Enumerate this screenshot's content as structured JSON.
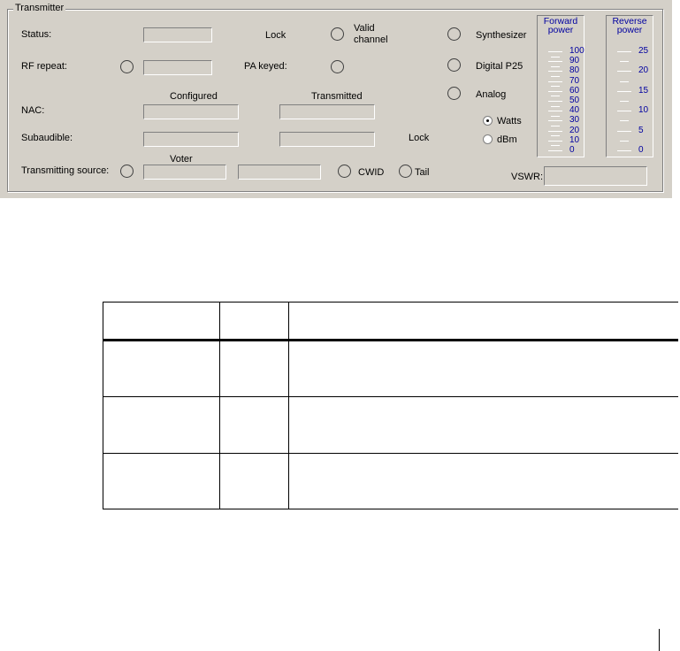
{
  "transmitter": {
    "group_title": "Transmitter",
    "status_label": "Status:",
    "lock_label": "Lock",
    "valid_channel_label_line1": "Valid",
    "valid_channel_label_line2": "channel",
    "synthesizer_label": "Synthesizer",
    "rf_repeat_label": "RF repeat:",
    "pa_keyed_label": "PA keyed:",
    "digital_p25_label": "Digital P25",
    "analog_label": "Analog",
    "configured_header": "Configured",
    "transmitted_header": "Transmitted",
    "nac_label": "NAC:",
    "subaudible_label": "Subaudible:",
    "subaudible_lock_label": "Lock",
    "voter_header": "Voter",
    "transmitting_source_label": "Transmitting source:",
    "cwid_label": "CWID",
    "tail_label": "Tail",
    "vswr_label": "VSWR:",
    "units": {
      "watts_label": "Watts",
      "dbm_label": "dBm",
      "selected": "Watts"
    },
    "forward_power": {
      "title_line1": "Forward",
      "title_line2": "power",
      "ticks": [
        "100",
        "90",
        "80",
        "70",
        "60",
        "50",
        "40",
        "30",
        "20",
        "10",
        "0"
      ]
    },
    "reverse_power": {
      "title_line1": "Reverse",
      "title_line2": "power",
      "ticks": [
        "25",
        "20",
        "15",
        "10",
        "5",
        "0"
      ]
    }
  },
  "colors": {
    "panel_bg": "#d4d0c8",
    "meter_text": "#0000a0"
  }
}
